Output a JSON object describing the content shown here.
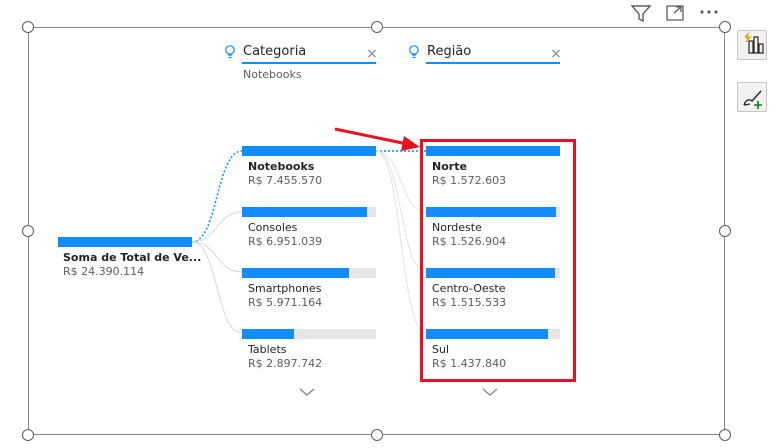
{
  "filters": [
    {
      "label": "Categoria",
      "selected": "Notebooks",
      "close": "×"
    },
    {
      "label": "Região",
      "selected": "",
      "close": "×"
    }
  ],
  "root": {
    "label": "Soma de Total de Ve...",
    "value": "R$ 24.390.114"
  },
  "categories": [
    {
      "label": "Notebooks",
      "value": "R$ 7.455.570",
      "fraction": 1.0,
      "selected": true
    },
    {
      "label": "Consoles",
      "value": "R$ 6.951.039",
      "fraction": 0.932
    },
    {
      "label": "Smartphones",
      "value": "R$ 5.971.164",
      "fraction": 0.8
    },
    {
      "label": "Tablets",
      "value": "R$ 2.897.742",
      "fraction": 0.389
    }
  ],
  "regions": [
    {
      "label": "Norte",
      "value": "R$ 1.572.603",
      "fraction": 1.0,
      "selected": true
    },
    {
      "label": "Nordeste",
      "value": "R$ 1.526.904",
      "fraction": 0.971
    },
    {
      "label": "Centro-Oeste",
      "value": "R$ 1.515.533",
      "fraction": 0.964
    },
    {
      "label": "Sul",
      "value": "R$ 1.437.840",
      "fraction": 0.914
    }
  ],
  "colors": {
    "accent": "#118dff",
    "highlight": "#e81123",
    "arrow": "#e81123"
  },
  "icons": {
    "toolbar": [
      "filter-icon",
      "focus-mode-icon",
      "more-options-icon"
    ],
    "side": [
      "smart-narrative-icon",
      "format-brush-icon"
    ]
  }
}
